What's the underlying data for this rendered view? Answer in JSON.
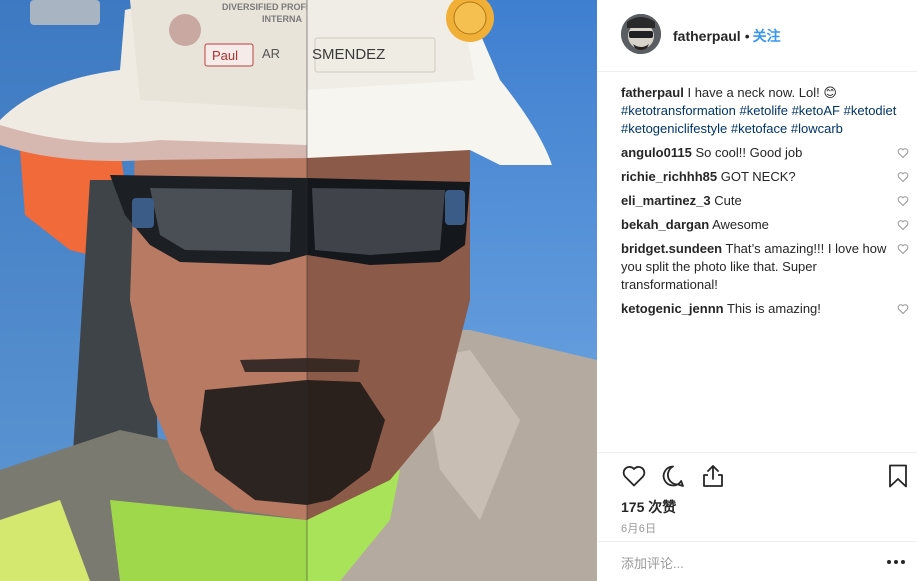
{
  "post": {
    "author": "fatherpaul",
    "separator": "•",
    "follow_label": "关注",
    "caption_text": "I have a neck now. Lol! 😊",
    "hashtags": [
      "#ketotransformation",
      "#ketolife",
      "#ketoAF",
      "#ketodiet",
      "#ketogeniclifestyle",
      "#ketoface",
      "#lowcarb"
    ],
    "likes_label": "175 次赞",
    "date_label": "6月6日",
    "comment_placeholder": "添加评论...",
    "more_label": "..."
  },
  "photo": {
    "helmet_text_top": "DIVERSIFIED PROFESSIONAL SERVICES",
    "helmet_text_mid": "INTERNA",
    "helmet_name_left": "Paul",
    "helmet_name_right": "SMENDEZ",
    "helmet_label_fragment": "AR"
  },
  "comments": [
    {
      "user": "angulo0115",
      "text": "So cool!! Good job"
    },
    {
      "user": "richie_richhh85",
      "text": "GOT NECK?"
    },
    {
      "user": "eli_martinez_3",
      "text": "Cute"
    },
    {
      "user": "bekah_dargan",
      "text": "Awesome"
    },
    {
      "user": "bridget.sundeen",
      "text": "That’s amazing!!! I love how you split the photo like that. Super transformational!"
    },
    {
      "user": "ketogenic_jennn",
      "text": "This is amazing!"
    }
  ],
  "icons": {
    "like": "heart-icon",
    "comment": "comment-bubble-icon",
    "share": "share-icon",
    "save": "bookmark-icon",
    "comment_like": "heart-outline-icon",
    "more": "more-dots-icon"
  },
  "colors": {
    "link": "#003569",
    "follow": "#3897f0",
    "meta": "#999999",
    "border": "#efefef",
    "sky": "#4a86c8"
  }
}
